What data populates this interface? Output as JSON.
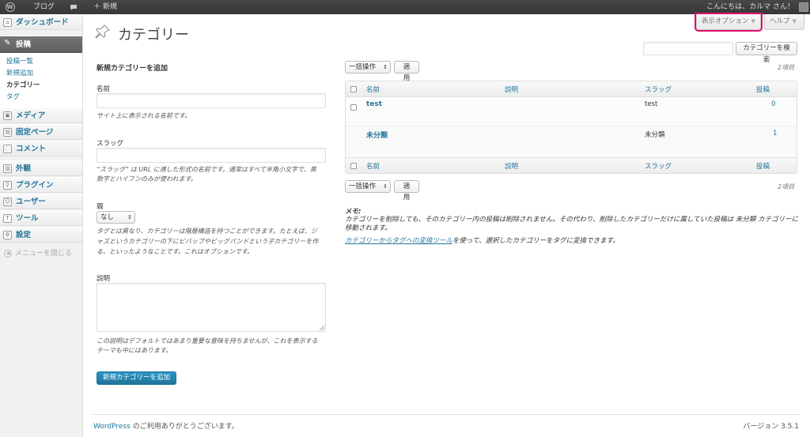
{
  "adminbar": {
    "site_name": "ブログ",
    "comment_icon": "speech-bubble-icon",
    "new_label": "＋ 新規",
    "greeting": "こんにちは、カルマ さん！"
  },
  "sidebar": {
    "items": [
      {
        "label": "ダッシュボード",
        "icon": "home-icon"
      },
      {
        "label": "投稿",
        "icon": "pin-icon"
      },
      {
        "label": "メディア",
        "icon": "media-icon"
      },
      {
        "label": "固定ページ",
        "icon": "page-icon"
      },
      {
        "label": "コメント",
        "icon": "comment-icon"
      },
      {
        "label": "外観",
        "icon": "appearance-icon"
      },
      {
        "label": "プラグイン",
        "icon": "plugin-icon"
      },
      {
        "label": "ユーザー",
        "icon": "users-icon"
      },
      {
        "label": "ツール",
        "icon": "tools-icon"
      },
      {
        "label": "設定",
        "icon": "settings-icon"
      }
    ],
    "submenu": [
      "投稿一覧",
      "新規追加",
      "カテゴリー",
      "タグ"
    ],
    "collapse": "メニューを閉じる"
  },
  "header": {
    "title": "カテゴリー",
    "screen_options": "表示オプション",
    "help": "ヘルプ"
  },
  "search": {
    "button": "カテゴリーを検索"
  },
  "form": {
    "title": "新規カテゴリーを追加",
    "name_label": "名前",
    "name_desc": "サイト上に表示される名前です。",
    "slug_label": "スラッグ",
    "slug_desc_1": "“スラッグ” は URL に適した形式の名前です。通常はすべて半角小文字で、英",
    "slug_desc_2": "数字とハイフンのみが使われます。",
    "parent_label": "親",
    "parent_value": "なし",
    "parent_desc_1": "タグとは異なり、カテゴリーは階層構造を持つことができます。たとえば、ジ",
    "parent_desc_2": "ャズというカテゴリーの下にビバップやビッグバンドという子カテゴリーを作",
    "parent_desc_3": "る、といったようなことです。これはオプションです。",
    "desc_label": "説明",
    "desc_desc_1": "この説明はデフォルトではあまり重要な意味を持ちませんが、これを表示する",
    "desc_desc_2": "テーマも中にはあります。",
    "submit": "新規カテゴリーを追加"
  },
  "list": {
    "bulk": "一括操作",
    "apply": "適用",
    "count": "2項目",
    "columns": [
      "名前",
      "説明",
      "スラッグ",
      "投稿"
    ],
    "rows": [
      {
        "name": "test",
        "description": "",
        "slug": "test",
        "count": "0"
      },
      {
        "name": "未分類",
        "description": "",
        "slug": "未分類",
        "count": "1"
      }
    ]
  },
  "note": {
    "title": "メモ:",
    "line1": "カテゴリーを削除しても、そのカテゴリー内の投稿は削除されません。その代わり、削除したカテゴリーだけに属していた投稿は 未分類 カテゴリーに移動されます。",
    "link": "カテゴリーからタグへの変換ツール",
    "line2": "を使って、選択したカテゴリーをタグに変換できます。"
  },
  "footer": {
    "link": "WordPress",
    "thanks": " のご利用ありがとうございます。",
    "version": "バージョン 3.5.1"
  },
  "colors": {
    "link": "#21759b",
    "highlight": "#e0106e",
    "adminbar": "#464646"
  }
}
